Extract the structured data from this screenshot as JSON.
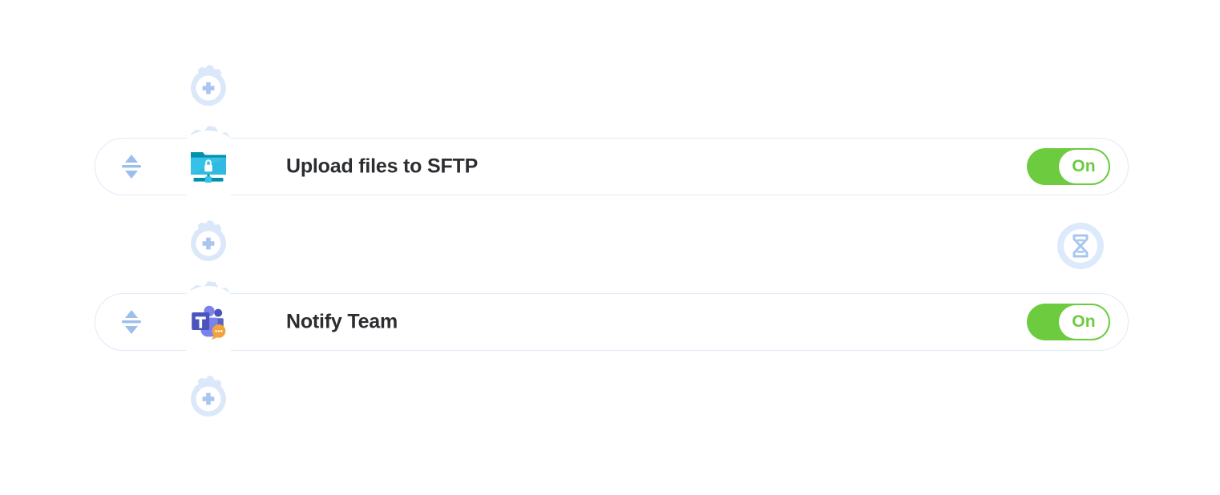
{
  "canvas": {
    "background_color": "#ffffff",
    "accent_blue": "#a8c6ee",
    "halo_blue": "#dbe8fa",
    "card_border": "#e0e9f8",
    "toggle_on_color": "#6ccb3e",
    "title_color": "#2b2d30"
  },
  "add_steps": [
    {
      "name": "add-step-top",
      "icon": "plus-gear-icon",
      "tooltip": "Add step"
    },
    {
      "name": "add-step-middle",
      "icon": "plus-gear-icon",
      "tooltip": "Add step"
    },
    {
      "name": "add-step-bottom",
      "icon": "plus-gear-icon",
      "tooltip": "Add step"
    }
  ],
  "steps": [
    {
      "id": "upload-files-to-sftp",
      "title": "Upload files to SFTP",
      "app_icon": "sftp-folder-lock-icon",
      "drag_handle_icon": "drag-updown-icon",
      "toggle": {
        "state": "on",
        "label": "On"
      }
    },
    {
      "id": "notify-team",
      "title": "Notify Team",
      "app_icon": "microsoft-teams-icon",
      "drag_handle_icon": "drag-updown-icon",
      "toggle": {
        "state": "on",
        "label": "On"
      }
    }
  ],
  "delay_marker": {
    "name": "delay-hourglass",
    "icon": "hourglass-icon",
    "label": ""
  }
}
